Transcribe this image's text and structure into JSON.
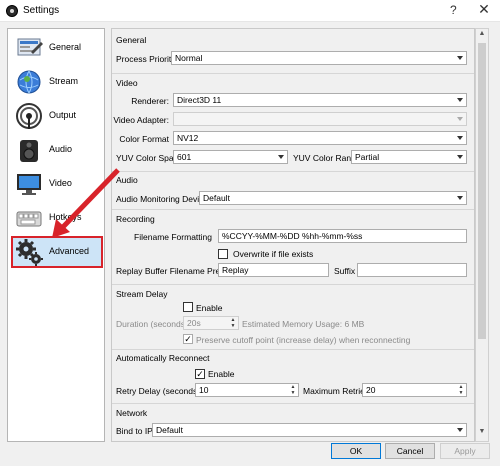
{
  "window": {
    "title": "Settings",
    "help": "?",
    "close": "✕"
  },
  "sidebar": {
    "items": [
      {
        "label": "General",
        "icon": "general-icon"
      },
      {
        "label": "Stream",
        "icon": "stream-icon"
      },
      {
        "label": "Output",
        "icon": "output-icon"
      },
      {
        "label": "Audio",
        "icon": "audio-icon"
      },
      {
        "label": "Video",
        "icon": "video-icon"
      },
      {
        "label": "Hotkeys",
        "icon": "hotkeys-icon"
      },
      {
        "label": "Advanced",
        "icon": "advanced-icon"
      }
    ],
    "selected": "Advanced"
  },
  "general": {
    "title": "General",
    "process_priority_label": "Process Priority",
    "process_priority_value": "Normal"
  },
  "video": {
    "title": "Video",
    "renderer_label": "Renderer:",
    "renderer_value": "Direct3D 11",
    "adapter_label": "Video Adapter:",
    "adapter_value": "",
    "color_format_label": "Color Format",
    "color_format_value": "NV12",
    "yuv_space_label": "YUV Color Space",
    "yuv_space_value": "601",
    "yuv_range_label": "YUV Color Range",
    "yuv_range_value": "Partial"
  },
  "audio": {
    "title": "Audio",
    "monitoring_label": "Audio Monitoring Device",
    "monitoring_value": "Default"
  },
  "recording": {
    "title": "Recording",
    "filename_label": "Filename Formatting",
    "filename_value": "%CCYY-%MM-%DD %hh-%mm-%ss",
    "overwrite_label": "Overwrite if file exists",
    "overwrite_checked": false,
    "replay_prefix_label": "Replay Buffer Filename Prefix",
    "replay_prefix_value": "Replay",
    "suffix_label": "Suffix",
    "suffix_value": ""
  },
  "stream_delay": {
    "title": "Stream Delay",
    "enable_label": "Enable",
    "enable_checked": false,
    "duration_label": "Duration (seconds)",
    "duration_value": "20s",
    "memory_text": "Estimated Memory Usage: 6 MB",
    "preserve_label": "Preserve cutoff point (increase delay) when reconnecting",
    "preserve_checked": true
  },
  "reconnect": {
    "title": "Automatically Reconnect",
    "enable_label": "Enable",
    "enable_checked": true,
    "retry_delay_label": "Retry Delay (seconds)",
    "retry_delay_value": "10",
    "max_retries_label": "Maximum Retries",
    "max_retries_value": "20"
  },
  "network": {
    "title": "Network",
    "bind_label": "Bind to IP",
    "bind_value": "Default"
  },
  "footer": {
    "ok": "OK",
    "cancel": "Cancel",
    "apply": "Apply"
  },
  "colors": {
    "highlight_border": "#d8232a",
    "selected_bg": "#cde4f7",
    "accent": "#0078d7"
  }
}
